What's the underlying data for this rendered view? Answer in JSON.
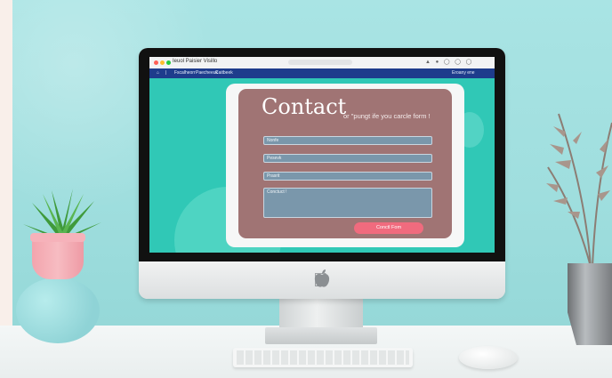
{
  "window": {
    "title": "Ieuol  Paisier  Visillo"
  },
  "nav": {
    "items": [
      "Fscalheorr",
      "Paecheeuk",
      "Caitbeek"
    ],
    "right": "Eroany ene"
  },
  "form": {
    "title": "Contact",
    "subtitle": "or \"pungt ife you carcle form !",
    "fields": [
      {
        "label": "Nonfe"
      },
      {
        "label": "Pesevk"
      },
      {
        "label": "Prasrit"
      }
    ],
    "message_placeholder": "Conctuct !",
    "submit_label": "Conctl Fom"
  },
  "colors": {
    "accent": "#f06b7e",
    "card": "#a07474",
    "screen_bg": "#30c8b6",
    "navbar": "#1e3c8c",
    "field": "#7a97ab"
  }
}
